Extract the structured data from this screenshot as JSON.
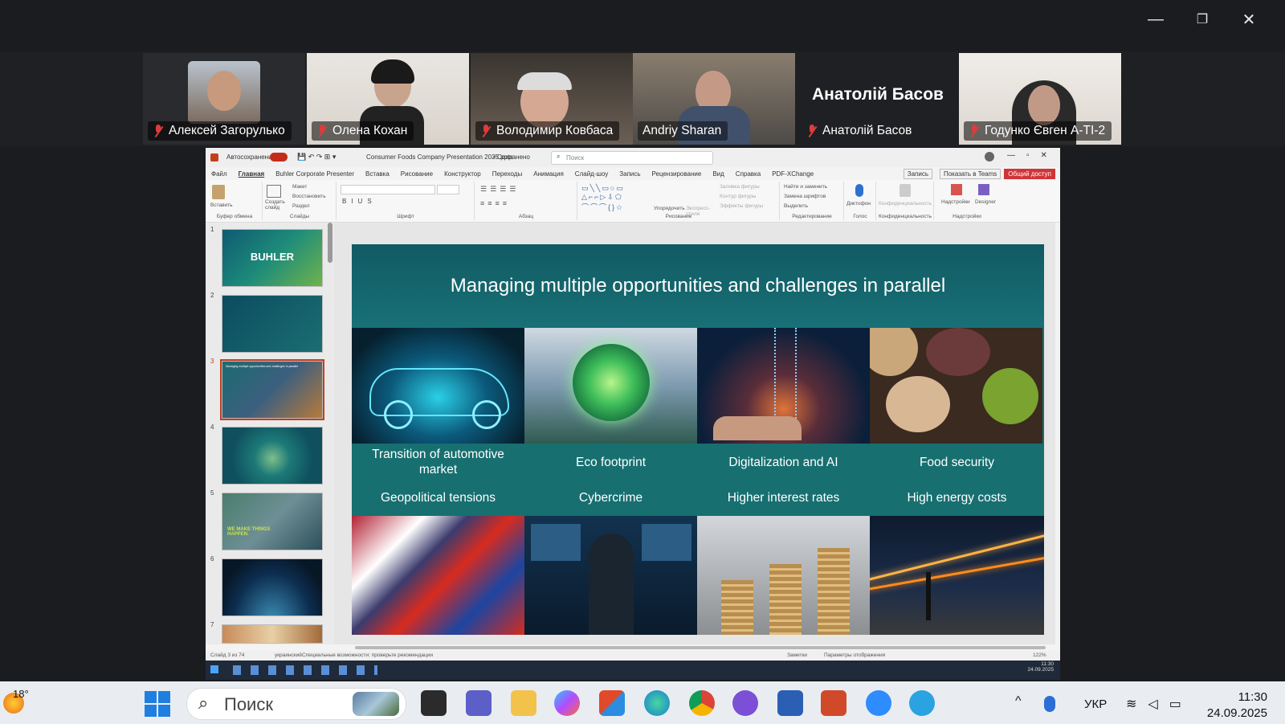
{
  "window_controls": {
    "minimize": "—",
    "restore": "❐",
    "close": "✕"
  },
  "participants": [
    {
      "name": "Алексей Загорулько",
      "muted": true
    },
    {
      "name": "Олена Кохан",
      "muted": true
    },
    {
      "name": "Володимир Ковбаса",
      "muted": true
    },
    {
      "name": "Andriy Sharan",
      "muted": false,
      "active": true
    },
    {
      "name": "Анатолій Басов",
      "muted": true,
      "big_name": "Анатолій Басов"
    },
    {
      "name": "Годунко Євген А-ТІ-2",
      "muted": true
    }
  ],
  "ppt": {
    "autosave": "Автосохранение",
    "filename": "Consumer Foods Company Presentation 2025.pptx",
    "saved": "• Сохранено",
    "search_placeholder": "Поиск",
    "menu": [
      "Файл",
      "Главная",
      "Buhler Corporate Presenter",
      "Вставка",
      "Рисование",
      "Конструктор",
      "Переходы",
      "Анимация",
      "Слайд-шоу",
      "Запись",
      "Рецензирование",
      "Вид",
      "Справка",
      "PDF-XChange"
    ],
    "right_buttons": {
      "record": "Запись",
      "teams": "Показать в Teams",
      "share": "Общий доступ"
    },
    "ribbon_groups": [
      "Буфер обмена",
      "Слайды",
      "Шрифт",
      "Абзац",
      "Рисование",
      "Редактирование",
      "Голос",
      "Конфиденциальность",
      "Надстройки"
    ],
    "ribbon_items": {
      "paste": "Вставить",
      "create_slide": "Создать слайд",
      "layout": "Макет",
      "reset": "Восстановить",
      "section": "Раздел",
      "arrange": "Упорядочить",
      "quick_styles": "Экспресс-стили",
      "fill": "Заливка фигуры",
      "outline": "Контур фигуры",
      "effects": "Эффекты фигуры",
      "find": "Найти и заменить",
      "replace_fonts": "Замена шрифтов",
      "select": "Выделить",
      "dictate": "Диктофон",
      "privacy": "Конфиденциальность",
      "addins": "Надстройки",
      "designer": "Designer"
    },
    "thumbnails": [
      {
        "num": "1",
        "text": "BUHLER"
      },
      {
        "num": "2",
        "text": ""
      },
      {
        "num": "3",
        "text": "Managing multiple opportunities and challenges in parallel"
      },
      {
        "num": "4",
        "text": ""
      },
      {
        "num": "5",
        "text": "WE MAKE THINGS HAPPEN."
      },
      {
        "num": "6",
        "text": ""
      },
      {
        "num": "7",
        "text": ""
      }
    ],
    "slide": {
      "title": "Managing multiple opportunities and challenges in parallel",
      "top_labels": [
        "Transition of automotive market",
        "Eco footprint",
        "Digitalization and AI",
        "Food security"
      ],
      "bottom_labels": [
        "Geopolitical tensions",
        "Cybercrime",
        "Higher interest rates",
        "High energy costs"
      ]
    },
    "status": {
      "slide": "Слайд 3 из 74",
      "lang": "украинский",
      "access": "Специальные возможности: проверьте рекомендации",
      "notes": "Заметки",
      "display": "Параметры отображения",
      "zoom": "122%"
    },
    "remote_clock": {
      "time": "11:30",
      "date": "24.09.2025"
    }
  },
  "taskbar": {
    "weather": "18°",
    "search": "Поиск",
    "lang": "УКР",
    "time": "11:30",
    "date": "24.09.2025"
  },
  "colors": {
    "accent_green": "#3ad17a",
    "slide_teal": "#187076",
    "share_red": "#d13438"
  }
}
